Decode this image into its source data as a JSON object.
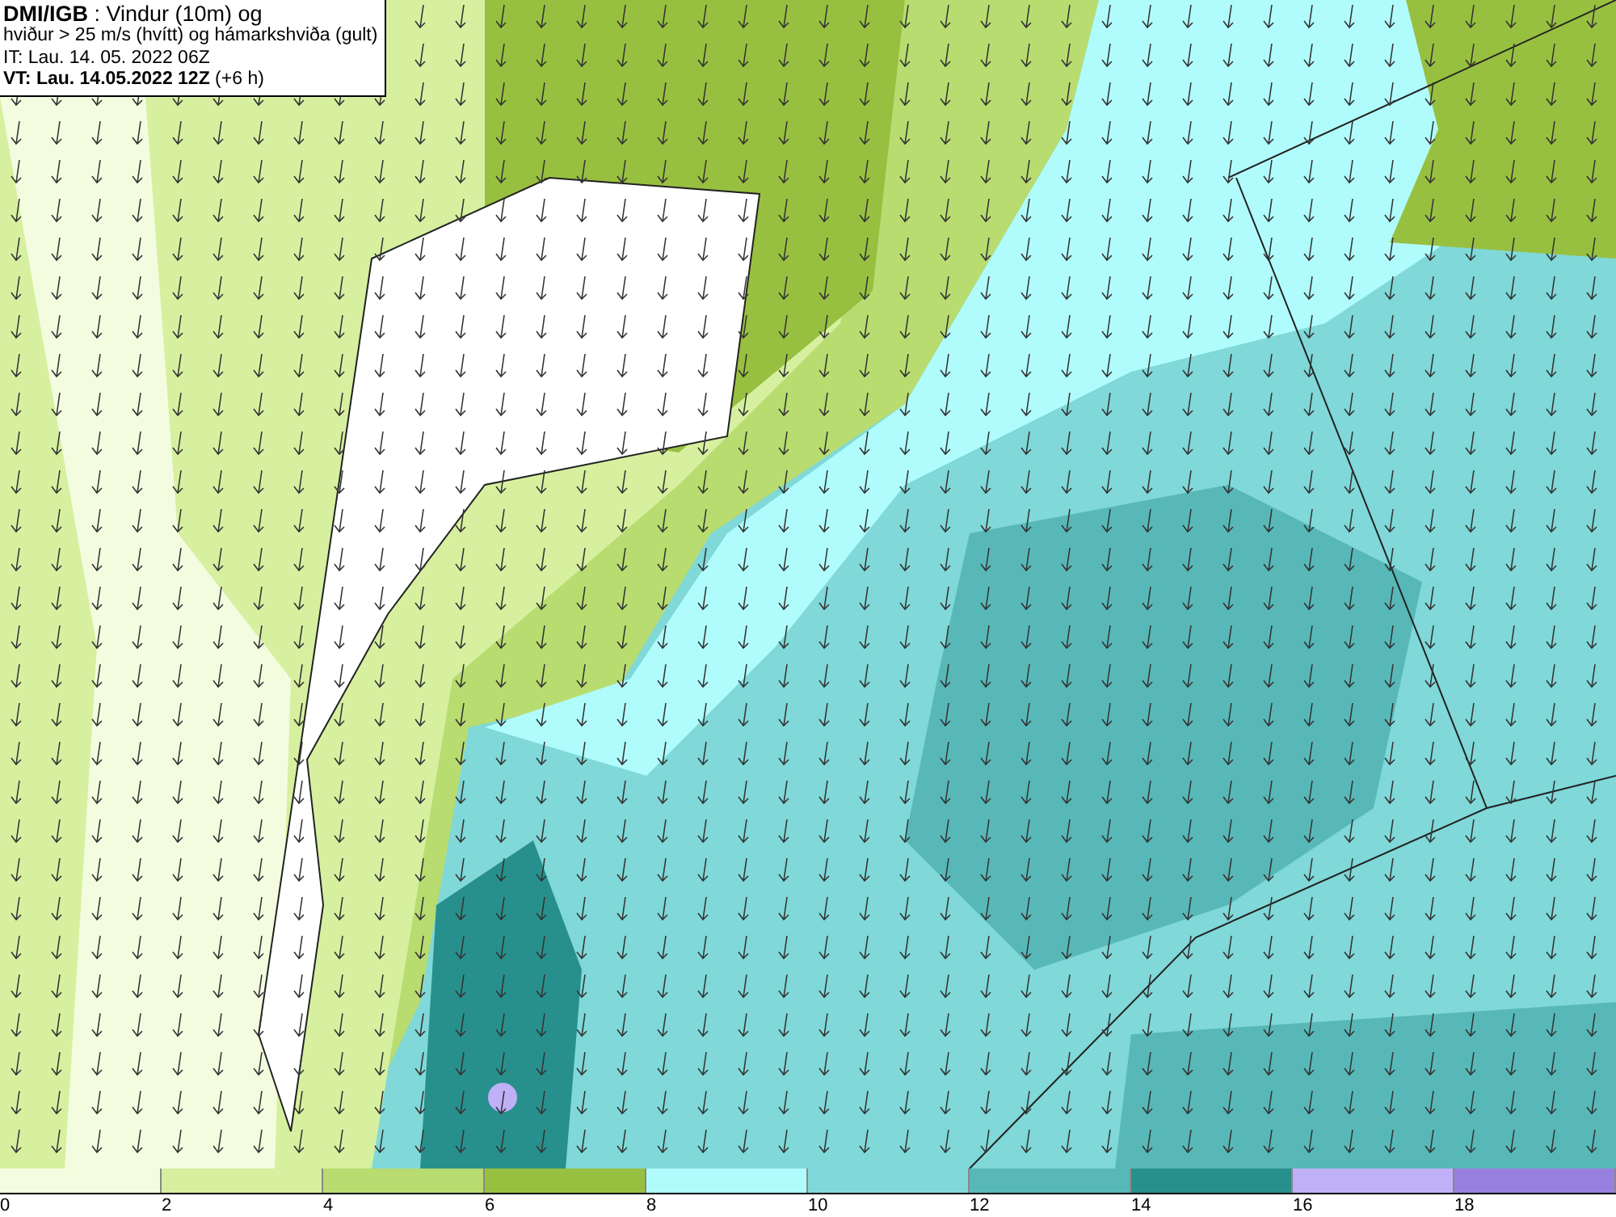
{
  "header": {
    "lines": [
      "**DMI/IGB** : Vindur (10m) og",
      "hviður > 25 m/s (hvítt) og hámarkshviða (gult)",
      "IT: Lau. 14. 05. 2022 06Z",
      "**VT: Lau. 14.05.2022 12Z** (+6 h)"
    ]
  },
  "legend": {
    "bins": [
      {
        "color": "#f4fce0"
      },
      {
        "color": "#d6f0a0"
      },
      {
        "color": "#b8dc70"
      },
      {
        "color": "#98c040"
      },
      {
        "color": "#b0fcfc"
      },
      {
        "color": "#80d8d8"
      },
      {
        "color": "#58b8b8"
      },
      {
        "color": "#28908c"
      },
      {
        "color": "#c0b0f8"
      },
      {
        "color": "#9880e0"
      }
    ],
    "ticks": [
      "0",
      "2",
      "4",
      "6",
      "8",
      "10",
      "12",
      "14",
      "16",
      "18"
    ]
  }
}
